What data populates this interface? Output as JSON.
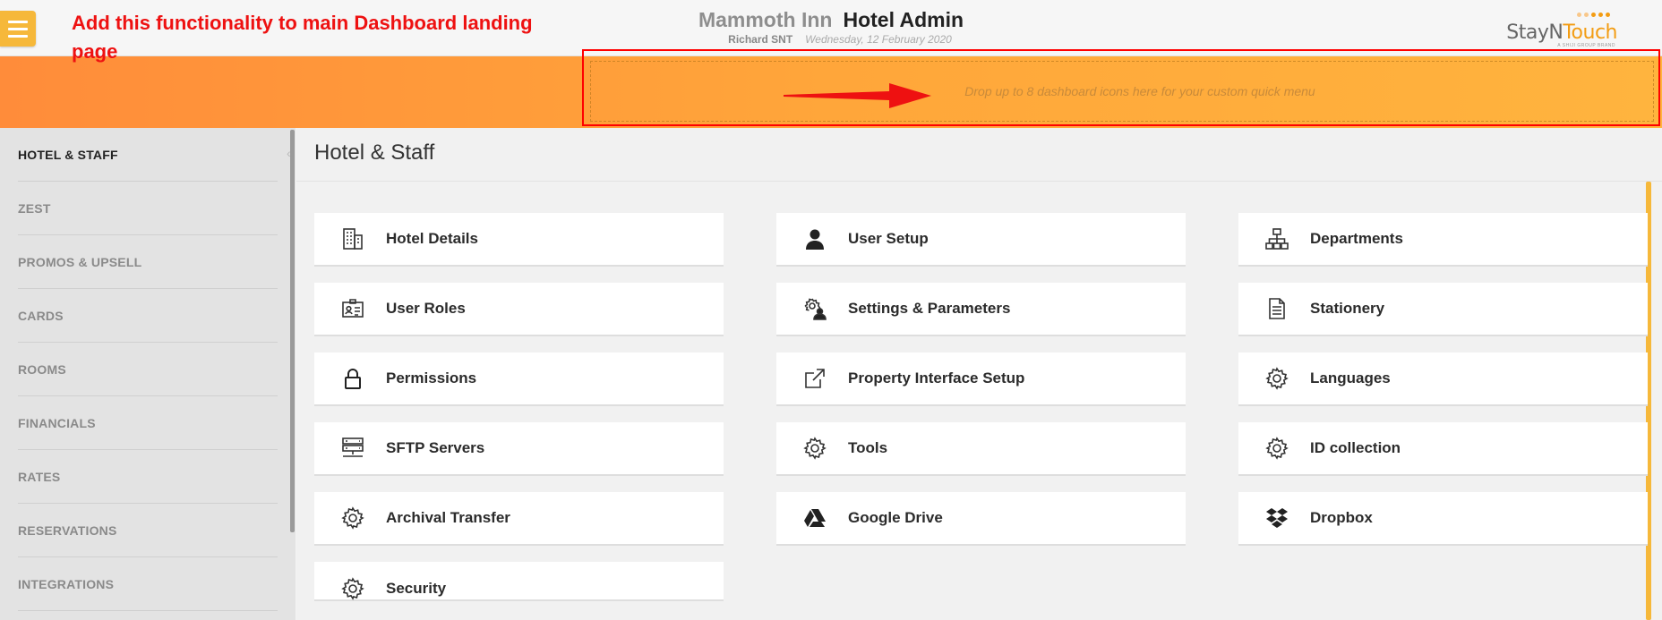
{
  "header": {
    "hotel_name": "Mammoth Inn",
    "app_name": "Hotel Admin",
    "user_name": "Richard SNT",
    "date": "Wednesday, 12 February 2020",
    "logo": {
      "text_a": "StayN",
      "text_b": "Touch",
      "tagline": "A SHIJI GROUP BRAND",
      "icon": "staylogo-dots"
    },
    "menu_icon": "hamburger-icon"
  },
  "annotation": {
    "text": "Add this functionality to main Dashboard landing page",
    "color": "#ee1111"
  },
  "dropzone": {
    "text": "Drop up to 8 dashboard icons here for your custom quick menu"
  },
  "sidebar": {
    "items": [
      {
        "label": "HOTEL & STAFF",
        "active": true
      },
      {
        "label": "ZEST"
      },
      {
        "label": "PROMOS & UPSELL"
      },
      {
        "label": "CARDS"
      },
      {
        "label": "ROOMS"
      },
      {
        "label": "FINANCIALS"
      },
      {
        "label": "RATES"
      },
      {
        "label": "RESERVATIONS"
      },
      {
        "label": "INTEGRATIONS"
      }
    ]
  },
  "main": {
    "title": "Hotel & Staff",
    "columns": [
      [
        {
          "label": "Hotel Details",
          "icon": "building-icon"
        },
        {
          "label": "User Roles",
          "icon": "id-card-icon"
        },
        {
          "label": "Permissions",
          "icon": "lock-icon"
        },
        {
          "label": "SFTP Servers",
          "icon": "server-icon"
        },
        {
          "label": "Archival Transfer",
          "icon": "gear-icon"
        },
        {
          "label": "Security",
          "icon": "gear-icon"
        }
      ],
      [
        {
          "label": "User Setup",
          "icon": "user-icon"
        },
        {
          "label": "Settings & Parameters",
          "icon": "user-gear-icon"
        },
        {
          "label": "Property Interface Setup",
          "icon": "external-link-icon"
        },
        {
          "label": "Tools",
          "icon": "gear-icon"
        },
        {
          "label": "Google Drive",
          "icon": "google-drive-icon"
        }
      ],
      [
        {
          "label": "Departments",
          "icon": "org-chart-icon"
        },
        {
          "label": "Stationery",
          "icon": "document-icon"
        },
        {
          "label": "Languages",
          "icon": "gear-icon"
        },
        {
          "label": "ID collection",
          "icon": "gear-icon"
        },
        {
          "label": "Dropbox",
          "icon": "dropbox-icon"
        }
      ]
    ]
  },
  "colors": {
    "accent": "#f6b83a",
    "band_start": "#ff8c3a",
    "band_end": "#ffb43e",
    "annotation_frame": "#ff0000"
  }
}
